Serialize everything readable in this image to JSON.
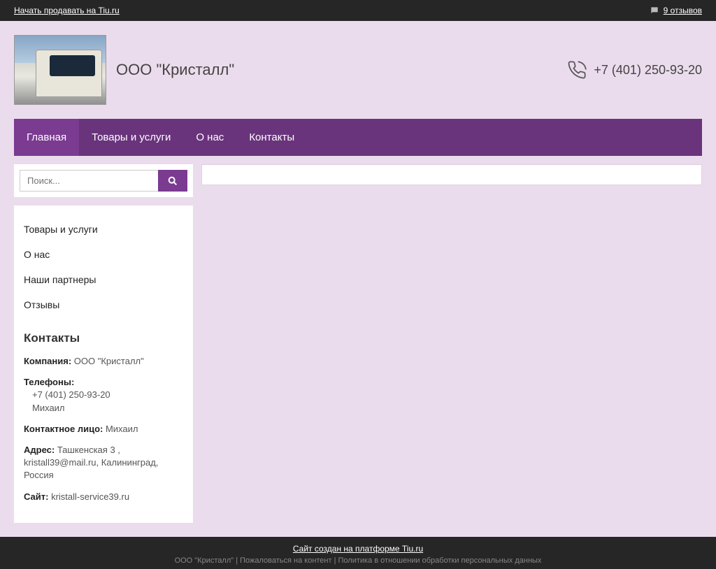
{
  "topbar": {
    "sell_link": "Начать продавать на Tiu.ru",
    "reviews": "9 отзывов"
  },
  "header": {
    "company": "ООО \"Кристалл\"",
    "phone": "+7 (401) 250-93-20"
  },
  "nav": [
    {
      "label": "Главная",
      "active": true
    },
    {
      "label": "Товары и услуги",
      "active": false
    },
    {
      "label": "О нас",
      "active": false
    },
    {
      "label": "Контакты",
      "active": false
    }
  ],
  "search": {
    "placeholder": "Поиск..."
  },
  "side_menu": [
    "Товары и услуги",
    "О нас",
    "Наши партнеры",
    "Отзывы"
  ],
  "contacts": {
    "heading": "Контакты",
    "company_label": "Компания:",
    "company_value": "ООО \"Кристалл\"",
    "phones_label": "Телефоны:",
    "phone_number": "+7 (401) 250-93-20",
    "phone_name": "Михаил",
    "contact_person_label": "Контактное лицо:",
    "contact_person_value": "Михаил",
    "address_label": "Адрес:",
    "address_value": "Ташкенская 3 , kristall39@mail.ru, Калининград, Россия",
    "site_label": "Сайт:",
    "site_value": "kristall-service39.ru"
  },
  "footer": {
    "platform": "Сайт создан на платформе Tiu.ru",
    "sub": "ООО \"Кристалл\" | Пожаловаться на контент | Политика в отношении обработки персональных данных"
  }
}
